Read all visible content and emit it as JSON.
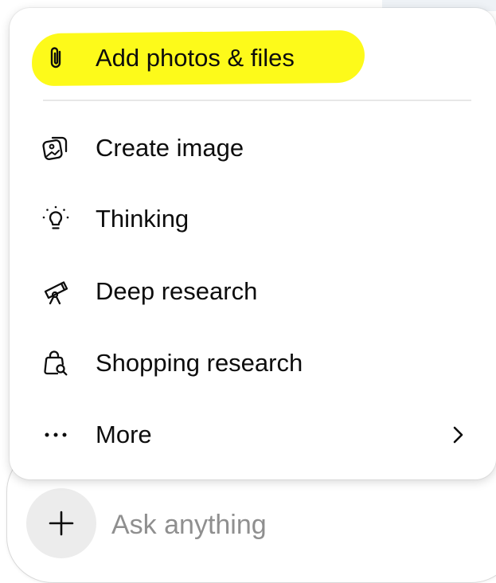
{
  "menu": {
    "items": [
      {
        "id": "add-photos-files",
        "label": "Add photos & files",
        "icon": "paperclip-icon",
        "highlighted": true
      },
      {
        "id": "create-image",
        "label": "Create image",
        "icon": "image-stack-icon"
      },
      {
        "id": "thinking",
        "label": "Thinking",
        "icon": "lightbulb-icon"
      },
      {
        "id": "deep-research",
        "label": "Deep research",
        "icon": "telescope-icon"
      },
      {
        "id": "shopping-research",
        "label": "Shopping research",
        "icon": "shopping-bag-search-icon"
      },
      {
        "id": "more",
        "label": "More",
        "icon": "ellipsis-icon",
        "submenu_indicator": "chevron-right-icon"
      }
    ]
  },
  "composer": {
    "placeholder": "Ask anything",
    "add_button_icon": "plus-icon"
  },
  "colors": {
    "highlight": "#fdfa1a",
    "text": "#0d0d0d",
    "placeholder": "#8f8f8f",
    "plus_button_bg": "#ececec"
  }
}
